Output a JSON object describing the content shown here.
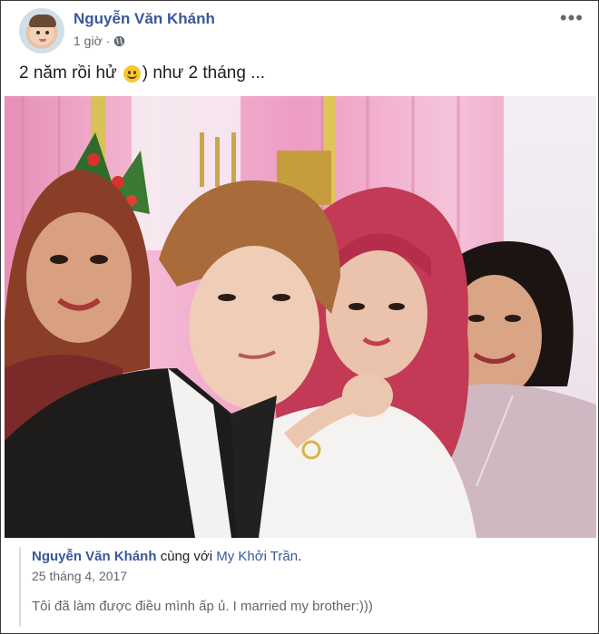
{
  "post": {
    "author_name": "Nguyễn Văn Khánh",
    "time": "1 giờ",
    "separator": "·",
    "audience_icon": "globe-icon",
    "more_icon": "more-horizontal-icon",
    "more_label": "•••",
    "text_before_emoji": "2 năm rồi hử",
    "emoji": "slightly-smiling-face",
    "text_after_emoji": ") như 2 tháng ...",
    "photo_subject": "selfie-of-four-people"
  },
  "shared_memory": {
    "author_name": "Nguyễn Văn Khánh",
    "with_text": "cùng với",
    "tagged_name": "My Khởi Trần",
    "period": ".",
    "date": "25 tháng 4, 2017",
    "text": "Tôi đã làm được điều mình ấp ủ. I married my brother:)))"
  },
  "colors": {
    "link_blue": "#385898",
    "text_primary": "#1c1e21",
    "text_secondary": "#616770",
    "photo_backdrop_pink": "#e8a7c4"
  }
}
